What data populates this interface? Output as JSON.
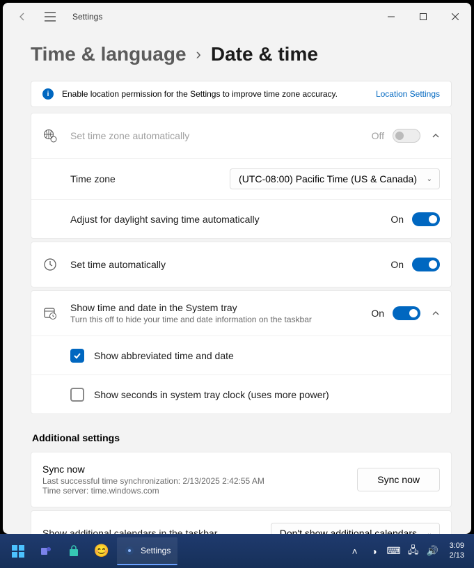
{
  "app": {
    "title": "Settings"
  },
  "breadcrumb": {
    "parent": "Time & language",
    "current": "Date & time"
  },
  "infobar": {
    "text": "Enable location permission for the Settings to improve time zone accuracy.",
    "link": "Location Settings"
  },
  "tz_auto": {
    "label": "Set time zone automatically",
    "state": "Off"
  },
  "tz": {
    "label": "Time zone",
    "value": "(UTC-08:00) Pacific Time (US & Canada)"
  },
  "dst": {
    "label": "Adjust for daylight saving time automatically",
    "state": "On"
  },
  "time_auto": {
    "label": "Set time automatically",
    "state": "On"
  },
  "tray_time": {
    "label": "Show time and date in the System tray",
    "sub": "Turn this off to hide your time and date information on the taskbar",
    "state": "On"
  },
  "abbrev": {
    "label": "Show abbreviated time and date"
  },
  "seconds": {
    "label": "Show seconds in system tray clock (uses more power)"
  },
  "additional": {
    "heading": "Additional settings"
  },
  "sync": {
    "title": "Sync now",
    "last": "Last successful time synchronization: 2/13/2025 2:42:55 AM",
    "server": "Time server: time.windows.com",
    "button": "Sync now"
  },
  "calendars": {
    "label": "Show additional calendars in the taskbar",
    "value": "Don't show additional calendars"
  },
  "taskbar": {
    "app_label": "Settings",
    "time": "3:09",
    "date": "2/13"
  }
}
